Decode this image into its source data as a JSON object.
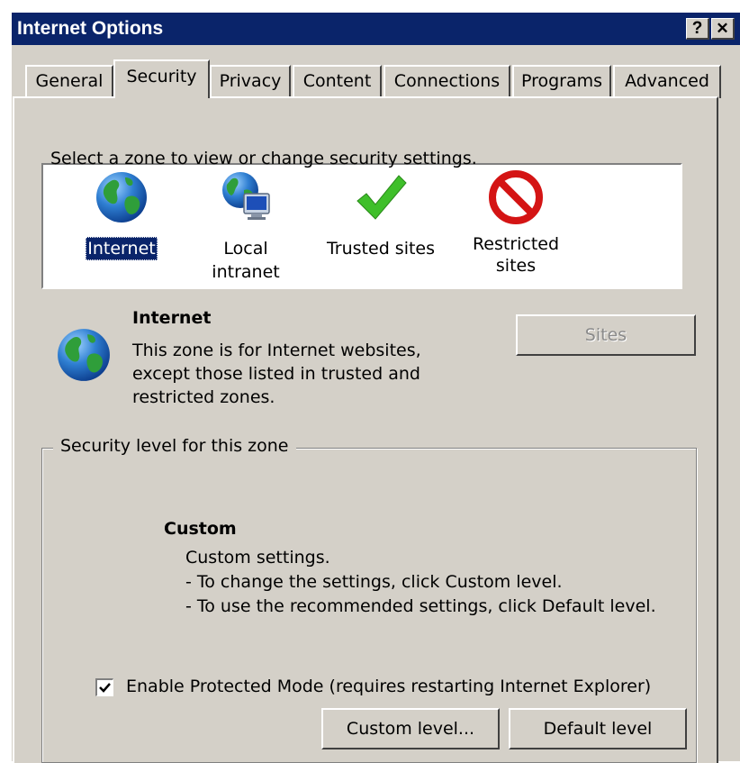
{
  "window": {
    "title": "Internet Options",
    "help_button": "?",
    "close_button": "✕"
  },
  "tabs": [
    {
      "label": "General",
      "active": false
    },
    {
      "label": "Security",
      "active": true
    },
    {
      "label": "Privacy",
      "active": false
    },
    {
      "label": "Content",
      "active": false
    },
    {
      "label": "Connections",
      "active": false
    },
    {
      "label": "Programs",
      "active": false
    },
    {
      "label": "Advanced",
      "active": false
    }
  ],
  "security": {
    "zone_prompt": "Select a zone to view or change security settings.",
    "zones": [
      {
        "label": "Internet",
        "icon": "globe-icon",
        "selected": true
      },
      {
        "label": "Local intranet",
        "icon": "intranet-icon",
        "selected": false
      },
      {
        "label": "Trusted sites",
        "icon": "checkmark-icon",
        "selected": false
      },
      {
        "label": "Restricted\nsites",
        "icon": "restricted-icon",
        "selected": false
      }
    ],
    "zone_info": {
      "name": "Internet",
      "desc_lines": [
        "This zone is for Internet websites,",
        "except those listed in trusted and",
        "restricted zones."
      ]
    },
    "sites_button": "Sites",
    "level_group": {
      "title": "Security level for this zone",
      "level_name": "Custom",
      "lines": [
        "Custom settings.",
        "- To change the settings, click Custom level.",
        "- To use the recommended settings, click Default level."
      ],
      "protected_mode_label": "Enable Protected Mode (requires restarting Internet Explorer)",
      "protected_mode_checked": true,
      "custom_level_button": "Custom level...",
      "default_level_button": "Default level"
    }
  },
  "colors": {
    "titlebar": "#0a246a",
    "face": "#d4d0c8",
    "selection": "#0a246a"
  }
}
